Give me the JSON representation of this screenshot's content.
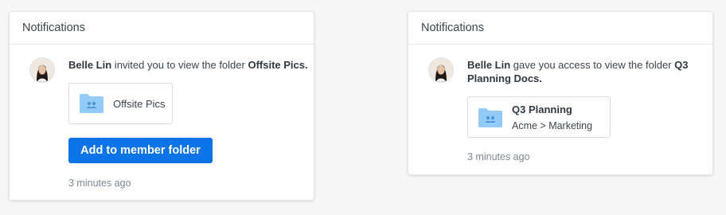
{
  "left_card": {
    "header": "Notifications",
    "message": {
      "actor": "Belle Lin",
      "action": " invited you to view the folder ",
      "folder": "Offsite Pics."
    },
    "folder_card": {
      "name": "Offsite Pics",
      "icon": "shared-folder-icon"
    },
    "button_label": "Add to member folder",
    "timestamp": "3 minutes ago"
  },
  "right_card": {
    "header": "Notifications",
    "message": {
      "actor": "Belle Lin",
      "action": " gave you access to view the folder ",
      "folder_line1": "Q3",
      "folder_line2": "Planning Docs."
    },
    "folder_card": {
      "name": "Q3 Planning",
      "path": "Acme > Marketing",
      "icon": "shared-folder-icon"
    },
    "timestamp": "3 minutes ago"
  },
  "colors": {
    "primary_button": "#0d74e8",
    "folder_icon": "#92cbf7",
    "background": "#f7f7f8"
  }
}
